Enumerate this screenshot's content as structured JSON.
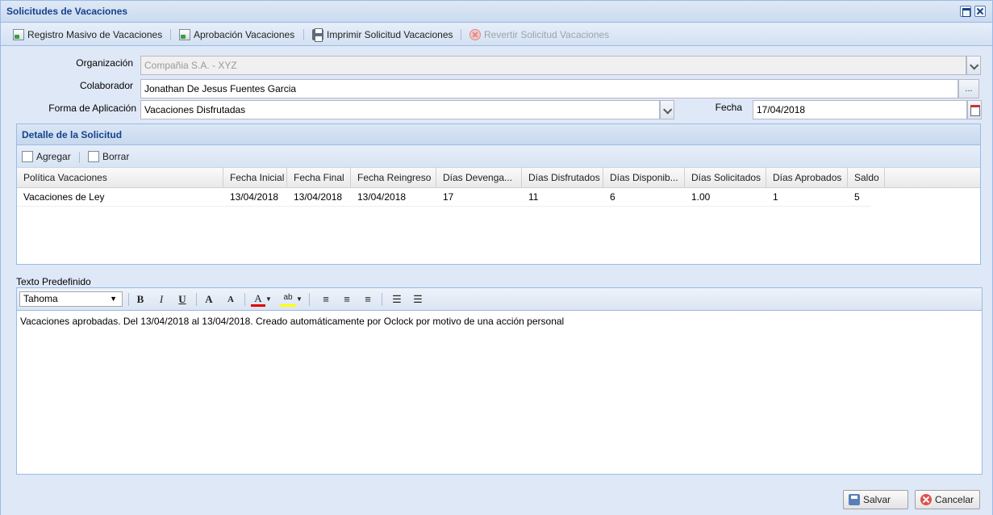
{
  "window": {
    "title": "Solicitudes de Vacaciones"
  },
  "toolbar": {
    "items": [
      {
        "label": "Registro Masivo de Vacaciones",
        "icon": "document-icon",
        "enabled": true
      },
      {
        "label": "Aprobación Vacaciones",
        "icon": "document-icon",
        "enabled": true
      },
      {
        "label": "Imprimir Solicitud Vacaciones",
        "icon": "printer-icon",
        "enabled": true
      },
      {
        "label": "Revertir Solicitud Vacaciones",
        "icon": "revert-icon",
        "enabled": false
      }
    ]
  },
  "form": {
    "organizacion": {
      "label": "Organización",
      "value": "Compañia S.A. - XYZ"
    },
    "colaborador": {
      "label": "Colaborador",
      "value": "Jonathan De Jesus Fuentes Garcia",
      "trigger": "..."
    },
    "forma_aplicacion": {
      "label": "Forma de Aplicación",
      "value": "Vacaciones Disfrutadas"
    },
    "fecha": {
      "label": "Fecha",
      "value": "17/04/2018"
    }
  },
  "detalle": {
    "title": "Detalle de la Solicitud",
    "add_label": "Agregar",
    "delete_label": "Borrar",
    "columns": [
      "Política Vacaciones",
      "Fecha Inicial",
      "Fecha Final",
      "Fecha Reingreso",
      "Días Devenga...",
      "Días Disfrutados",
      "Días Disponib...",
      "Días Solicitados",
      "Días Aprobados",
      "Saldo"
    ],
    "rows": [
      [
        "Vacaciones de Ley",
        "13/04/2018",
        "13/04/2018",
        "13/04/2018",
        "17",
        "11",
        "6",
        "1.00",
        "1",
        "5"
      ]
    ]
  },
  "editor": {
    "label": "Texto Predefinido",
    "font": "Tahoma",
    "buttons": {
      "bold": "B",
      "italic": "I",
      "underline": "U",
      "grow": "A",
      "shrink": "A",
      "fontcolor": "A",
      "highlight": "ab"
    },
    "content": "Vacaciones aprobadas. Del 13/04/2018 al 13/04/2018. Creado automáticamente por Oclock por motivo de una acción personal"
  },
  "footer": {
    "save_label": "Salvar",
    "cancel_label": "Cancelar"
  },
  "colors": {
    "title": "#15428b",
    "panel_border": "#99bbe8",
    "background": "#dfe8f6"
  }
}
